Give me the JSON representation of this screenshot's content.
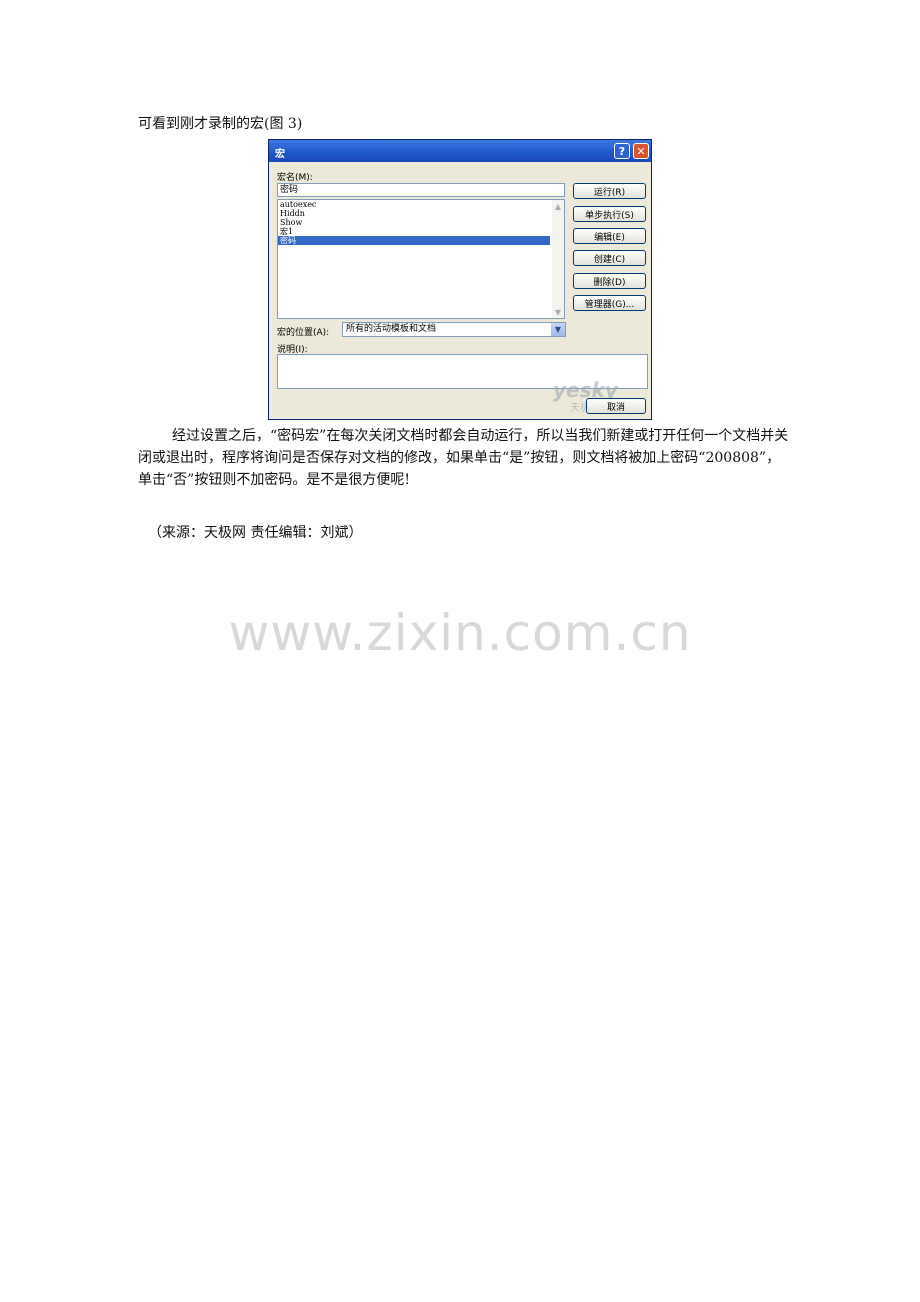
{
  "intro": "可看到刚才录制的宏(图 3)",
  "dialog": {
    "title": "宏",
    "help_label": "?",
    "close_label": "✕",
    "macro_name_label": "宏名(M):",
    "macro_name_value": "密码",
    "macros": [
      "autoexec",
      "Hiddn",
      "Show",
      "宏1",
      "密码"
    ],
    "selected_macro": "密码",
    "buttons": {
      "run": "运行(R)",
      "step_into": "单步执行(S)",
      "edit": "编辑(E)",
      "create": "创建(C)",
      "delete": "删除(D)",
      "organizer": "管理器(G)..."
    },
    "location_label": "宏的位置(A):",
    "location_value": "所有的活动模板和文档",
    "description_label": "说明(I):",
    "description_value": "",
    "cancel": "取消",
    "watermark_logo": "yesky",
    "watermark_sub": "天极网"
  },
  "body_text": "经过设置之后，“密码宏”在每次关闭文档时都会自动运行，所以当我们新建或打开任何一个文档并关闭或退出时，程序将询问是否保存对文档的修改，如果单击“是”按钮，则文档将被加上密码“200808”，单击“否”按钮则不加密码。是不是很方便呢!",
  "source": "（来源：天极网  责任编辑：刘斌）",
  "watermark": "www.zixin.com.cn"
}
